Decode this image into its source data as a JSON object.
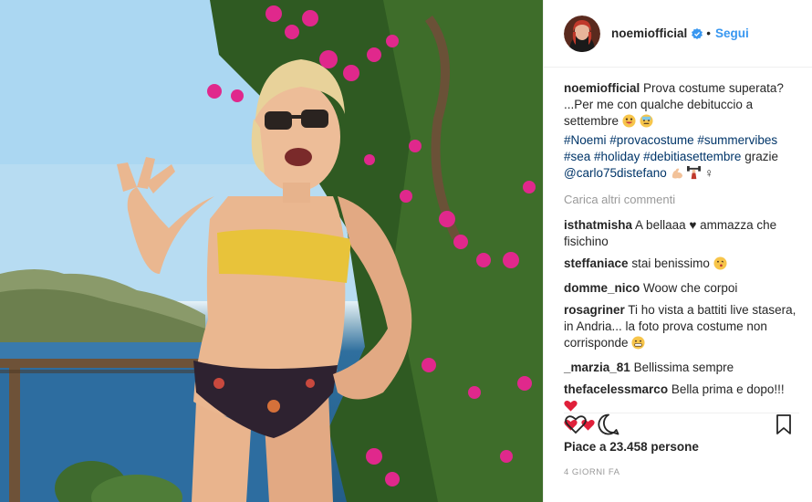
{
  "post": {
    "username": "noemiofficial",
    "follow_label": "Segui",
    "dot": "•",
    "caption_text_1": "Prova costume superata? ...Per me con qualche debituccio a settembre",
    "caption_tags": [
      "#Noemi",
      "#provacostume",
      "#summervibes",
      "#sea",
      "#holiday",
      "#debitiasettembre"
    ],
    "caption_after_tags": "grazie",
    "caption_mention": "@carlo75distefano",
    "load_more": "Carica altri commenti",
    "likes_text": "Piace a 23.458 persone",
    "time_text": "4 GIORNI FA"
  },
  "comments": [
    {
      "user": "isthatmisha",
      "text": "A bellaaa ♥ ammazza che fisichino"
    },
    {
      "user": "steffaniace",
      "text": "stai benissimo"
    },
    {
      "user": "domme_nico",
      "text": "Woow che corpoi"
    },
    {
      "user": "rosagriner",
      "text": "Ti ho vista a battiti live stasera, in Andria... la foto prova costume non corrisponde"
    },
    {
      "user": "_marzia_81",
      "text": "Bellissima sempre"
    },
    {
      "user": "thefacelessmarco",
      "text": "Bella prima e dopo!!!"
    }
  ],
  "icons": {
    "verified": "verified-badge-icon",
    "like": "heart-outline-icon",
    "comment": "comment-bubble-icon",
    "save": "bookmark-icon"
  },
  "colors": {
    "accent": "#3897f0",
    "hashtag": "#003569",
    "muted": "#999999",
    "heart": "#ed4956",
    "bikini_top": "#e8c33a"
  }
}
